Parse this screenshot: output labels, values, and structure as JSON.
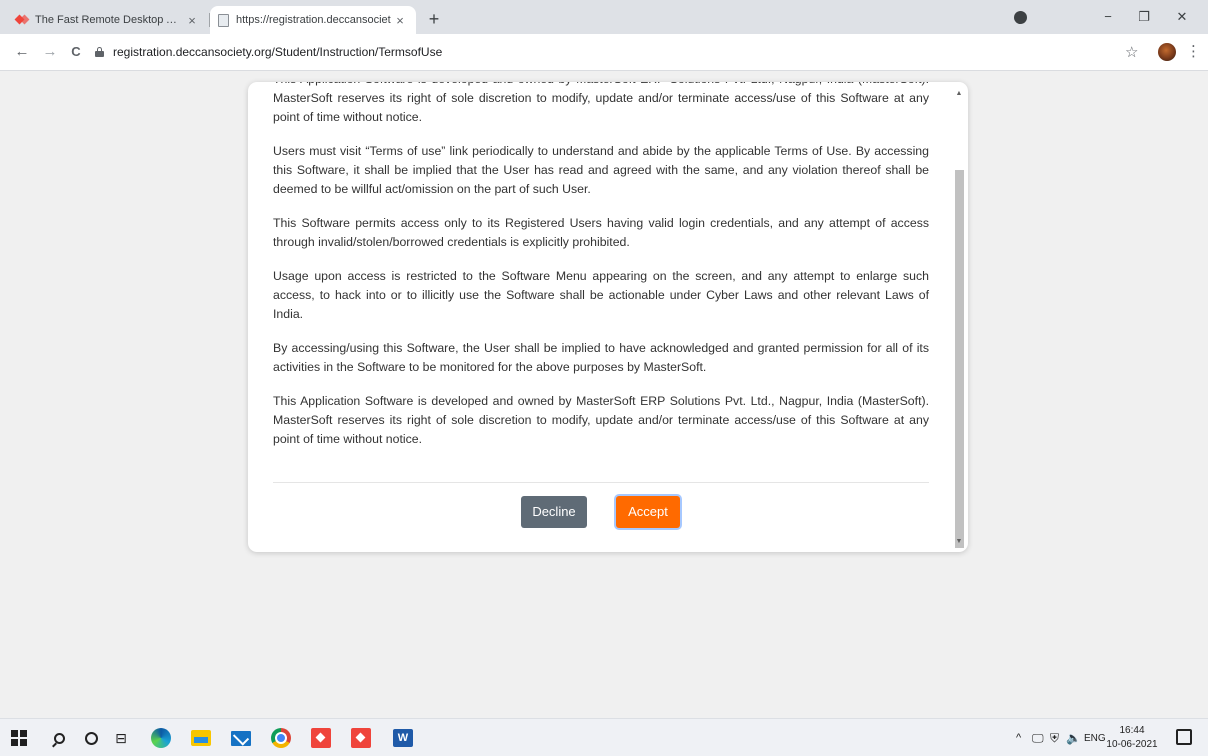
{
  "browser": {
    "tabs": [
      {
        "title": "The Fast Remote Desktop Applica",
        "active": false
      },
      {
        "title": "https://registration.deccansociet",
        "active": true
      }
    ],
    "new_tab_label": "+",
    "close_glyph": "×",
    "window_controls": {
      "minimize": "−",
      "maximize": "❐",
      "close": "✕"
    },
    "nav": {
      "back": "←",
      "forward": "→",
      "reload": "C"
    },
    "url": "registration.deccansociety.org/Student/Instruction/TermsofUse",
    "star": "☆",
    "menu": "⋮"
  },
  "modal": {
    "paragraphs": [
      "This Application Software is developed and owned by MasterSoft ERP Solutions Pvt. Ltd., Nagpur, India (MasterSoft). MasterSoft reserves its right of sole discretion to modify, update and/or terminate access/use of this Software at any point of time without notice.",
      "Users must visit “Terms of use” link periodically to understand and abide by the applicable Terms of Use. By accessing this Software, it shall be implied that the User has read and agreed with the same, and any violation thereof shall be deemed to be willful act/omission on the part of such User.",
      "This Software permits access only to its Registered Users having valid login credentials, and any attempt of access through invalid/stolen/borrowed credentials is explicitly prohibited.",
      "Usage upon access is restricted to the Software Menu appearing on the screen, and any attempt to enlarge such access, to hack into or to illicitly use the Software shall be actionable under Cyber Laws and other relevant Laws of India.",
      "By accessing/using this Software, the User shall be implied to have acknowledged and granted permission for all of its activities in the Software to be monitored for the above purposes by MasterSoft.",
      "This Application Software is developed and owned by MasterSoft ERP Solutions Pvt. Ltd., Nagpur, India (MasterSoft). MasterSoft reserves its right of sole discretion to modify, update and/or terminate access/use of this Software at any point of time without notice."
    ],
    "decline_label": "Decline",
    "accept_label": "Accept",
    "scroll_up": "▲",
    "scroll_down": "▼"
  },
  "taskbar": {
    "tray_caret": "^",
    "language": "ENG",
    "time": "16:44",
    "date": "10-06-2021",
    "word_letter": "W"
  },
  "colors": {
    "accept": "#ff6a00",
    "decline": "#5f6b76",
    "page_bg": "#f0f0f0"
  }
}
